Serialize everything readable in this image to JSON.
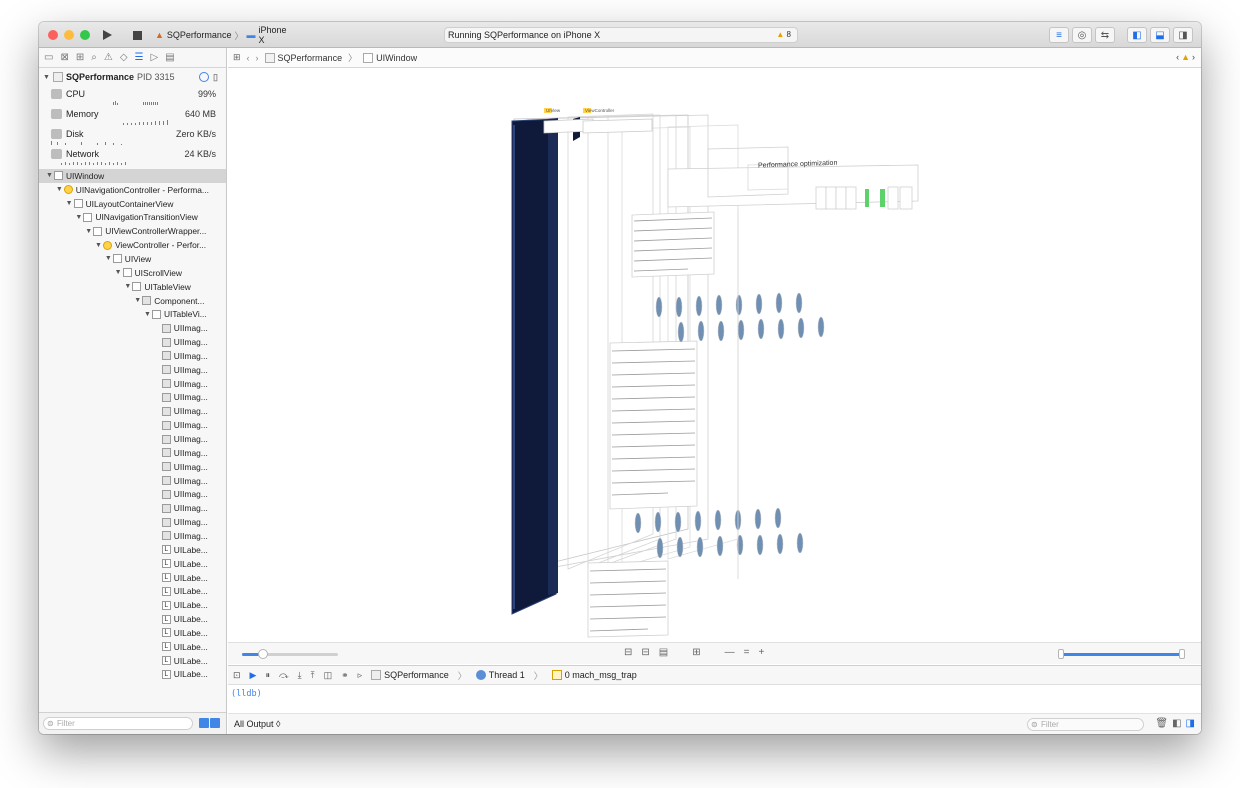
{
  "window": {
    "scheme": {
      "app": "SQPerformance",
      "device": "iPhone X"
    },
    "status_text": "Running SQPerformance on iPhone X",
    "warnings_count": "8"
  },
  "navigator": {
    "process": {
      "name": "SQPerformance",
      "pid": "PID 3315"
    },
    "gauges": [
      {
        "label": "CPU",
        "value": "99%"
      },
      {
        "label": "Memory",
        "value": "640 MB"
      },
      {
        "label": "Disk",
        "value": "Zero KB/s"
      },
      {
        "label": "Network",
        "value": "24 KB/s"
      }
    ],
    "tree": [
      {
        "label": "UIWindow",
        "depth": 0,
        "kind": "box",
        "selected": true
      },
      {
        "label": "UINavigationController - Performa...",
        "depth": 1,
        "kind": "yellow"
      },
      {
        "label": "UILayoutContainerView",
        "depth": 2,
        "kind": "box"
      },
      {
        "label": "UINavigationTransitionView",
        "depth": 3,
        "kind": "box"
      },
      {
        "label": "UIViewControllerWrapper...",
        "depth": 4,
        "kind": "box"
      },
      {
        "label": "ViewController - Perfor...",
        "depth": 5,
        "kind": "yellow"
      },
      {
        "label": "UIView",
        "depth": 6,
        "kind": "box"
      },
      {
        "label": "UIScrollView",
        "depth": 7,
        "kind": "box"
      },
      {
        "label": "UITableView",
        "depth": 8,
        "kind": "box"
      },
      {
        "label": "Component...",
        "depth": 9,
        "kind": "img"
      },
      {
        "label": "UITableVi...",
        "depth": 10,
        "kind": "box"
      },
      {
        "label": "UIImag...",
        "depth": 11,
        "kind": "img"
      },
      {
        "label": "UIImag...",
        "depth": 11,
        "kind": "img"
      },
      {
        "label": "UIImag...",
        "depth": 11,
        "kind": "img"
      },
      {
        "label": "UIImag...",
        "depth": 11,
        "kind": "img"
      },
      {
        "label": "UIImag...",
        "depth": 11,
        "kind": "img"
      },
      {
        "label": "UIImag...",
        "depth": 11,
        "kind": "img"
      },
      {
        "label": "UIImag...",
        "depth": 11,
        "kind": "img"
      },
      {
        "label": "UIImag...",
        "depth": 11,
        "kind": "img"
      },
      {
        "label": "UIImag...",
        "depth": 11,
        "kind": "img"
      },
      {
        "label": "UIImag...",
        "depth": 11,
        "kind": "img"
      },
      {
        "label": "UIImag...",
        "depth": 11,
        "kind": "img"
      },
      {
        "label": "UIImag...",
        "depth": 11,
        "kind": "img"
      },
      {
        "label": "UIImag...",
        "depth": 11,
        "kind": "img"
      },
      {
        "label": "UIImag...",
        "depth": 11,
        "kind": "img"
      },
      {
        "label": "UIImag...",
        "depth": 11,
        "kind": "img"
      },
      {
        "label": "UIImag...",
        "depth": 11,
        "kind": "img"
      },
      {
        "label": "UILabe...",
        "depth": 11,
        "kind": "lbl"
      },
      {
        "label": "UILabe...",
        "depth": 11,
        "kind": "lbl"
      },
      {
        "label": "UILabe...",
        "depth": 11,
        "kind": "lbl"
      },
      {
        "label": "UILabe...",
        "depth": 11,
        "kind": "lbl"
      },
      {
        "label": "UILabe...",
        "depth": 11,
        "kind": "lbl"
      },
      {
        "label": "UILabe...",
        "depth": 11,
        "kind": "lbl"
      },
      {
        "label": "UILabe...",
        "depth": 11,
        "kind": "lbl"
      },
      {
        "label": "UILabe...",
        "depth": 11,
        "kind": "lbl"
      },
      {
        "label": "UILabe...",
        "depth": 11,
        "kind": "lbl"
      },
      {
        "label": "UILabe...",
        "depth": 11,
        "kind": "lbl"
      }
    ],
    "filter_placeholder": "Filter"
  },
  "jumpbar": {
    "project": "SQPerformance",
    "item": "UIWindow"
  },
  "canvas": {
    "nav_title": "Performance optimization",
    "small_label_1": "UIView",
    "small_label_2": "ViewController",
    "spacing_level": 0.22,
    "zoom_level": 0.98
  },
  "debug_bar": {
    "target": "SQPerformance",
    "thread": "Thread 1",
    "frame": "0 mach_msg_trap"
  },
  "console": {
    "prompt": "(lldb)",
    "output_selector": "All Output ◊",
    "filter_placeholder": "Filter"
  },
  "colors": {
    "accent": "#3f86e6",
    "close": "#fc605c",
    "minimize": "#fdbc40",
    "zoom": "#34c84a",
    "warning": "#e5a100",
    "window_layer": "#0f1a3a"
  },
  "icons": [
    "run-icon",
    "stop-icon",
    "warning-icon",
    "search-icon",
    "filter-icon",
    "trash-icon"
  ]
}
